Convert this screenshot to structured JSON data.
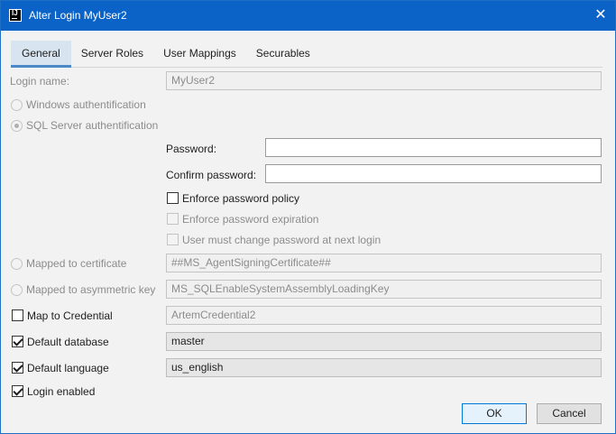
{
  "window": {
    "title": "Alter Login MyUser2",
    "close_glyph": "✕"
  },
  "tabs": [
    {
      "label": "General",
      "active": true
    },
    {
      "label": "Server Roles",
      "active": false
    },
    {
      "label": "User Mappings",
      "active": false
    },
    {
      "label": "Securables",
      "active": false
    }
  ],
  "general": {
    "login_name_label": "Login name:",
    "login_name_value": "MyUser2",
    "windows_auth_label": "Windows authentification",
    "sql_auth_label": "SQL Server authentification",
    "password_label": "Password:",
    "password_value": "",
    "confirm_password_label": "Confirm password:",
    "confirm_password_value": "",
    "enforce_policy_label": "Enforce password policy",
    "enforce_expiration_label": "Enforce password expiration",
    "must_change_label": "User must change password at next login",
    "mapped_cert_label": "Mapped to certificate",
    "mapped_cert_value": "##MS_AgentSigningCertificate##",
    "mapped_asym_label": "Mapped to asymmetric key",
    "mapped_asym_value": "MS_SQLEnableSystemAssemblyLoadingKey",
    "map_credential_label": "Map to Credential",
    "map_credential_value": "ArtemCredential2",
    "default_db_label": "Default database",
    "default_db_value": "master",
    "default_lang_label": "Default language",
    "default_lang_value": "us_english",
    "login_enabled_label": "Login enabled"
  },
  "buttons": {
    "ok": "OK",
    "cancel": "Cancel"
  },
  "colors": {
    "titlebar": "#0b63c7",
    "accent": "#4a88c7"
  }
}
